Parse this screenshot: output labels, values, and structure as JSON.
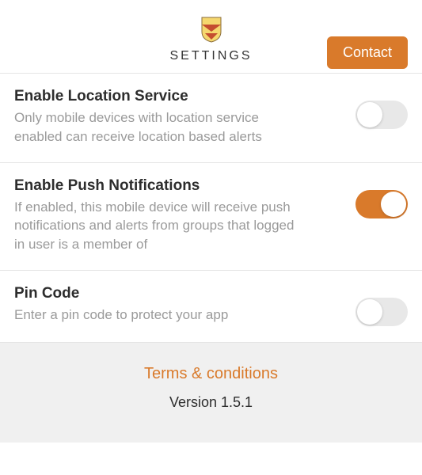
{
  "header": {
    "title": "SETTINGS",
    "contact_label": "Contact"
  },
  "settings": [
    {
      "title": "Enable Location Service",
      "desc": "Only mobile devices with location service enabled can receive location based alerts",
      "enabled": false
    },
    {
      "title": "Enable Push Notifications",
      "desc": "If enabled, this mobile device will receive push notifications and alerts from groups that logged in user is a member of",
      "enabled": true
    },
    {
      "title": "Pin Code",
      "desc": "Enter a pin code to protect your app",
      "enabled": false
    }
  ],
  "footer": {
    "terms_label": "Terms & conditions",
    "version_label": "Version 1.5.1"
  }
}
